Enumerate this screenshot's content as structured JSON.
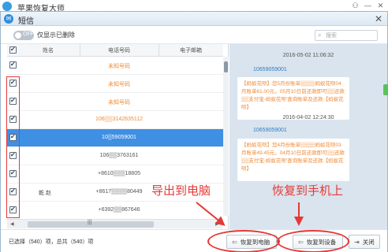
{
  "app": {
    "title": "苹果恢复大师",
    "controls": [
      "⚇",
      "—",
      "✕"
    ]
  },
  "dialog": {
    "title": "短信",
    "close": "✕"
  },
  "toolbar": {
    "toggle_text": "OFF",
    "toggle_label": "仅显示已删除",
    "search_placeholder": "搜索"
  },
  "table": {
    "columns": [
      "姓名",
      "电话号码",
      "电子邮箱"
    ],
    "rows": [
      {
        "name": "",
        "phone": "未知号码",
        "orange": true,
        "selected": false
      },
      {
        "name": "",
        "phone": "未知号码",
        "orange": true,
        "selected": false
      },
      {
        "name": "",
        "phone": "未知号码",
        "orange": true,
        "selected": false
      },
      {
        "name": "",
        "phone": "106▒▒3142635112",
        "orange": true,
        "selected": false
      },
      {
        "name": "",
        "phone": "10▒59059001",
        "orange": false,
        "selected": true
      },
      {
        "name": "",
        "phone": "106▒▒3763161",
        "orange": false,
        "selected": false
      },
      {
        "name": "",
        "phone": "+8610▒▒▒18805",
        "orange": false,
        "selected": false
      },
      {
        "name": "乾 赵",
        "phone": "+8617▒▒▒▒80449",
        "orange": false,
        "selected": false
      },
      {
        "name": "",
        "phone": "+6392▒▒867646",
        "orange": false,
        "selected": false
      }
    ]
  },
  "messages": [
    {
      "date": "2016-05-02 11:06:32",
      "sender": "10659059001",
      "text": "【蚂蚁花呗】您5月份账单▒▒▒▒蚂蚁花呗04月账单61.00元，05月10日前还款即可▒▒还款▒▒支付宝-蚂蚁花呗'查询账单及还款【蚂蚁花呗】"
    },
    {
      "date": "2016-04-02 12:24:30",
      "sender": "10659059001",
      "text": "【蚂蚁花呗】您4月份账单▒▒▒▒蚂蚁花呗03月账单49.45元，04月10日前还款即可▒▒还款▒▒支付宝-蚂蚁花呗'查询账单及还款【蚂蚁花呗】"
    }
  ],
  "status": {
    "text": "已选择（540）项，总共（540）项"
  },
  "buttons": {
    "restore_to_pc": "恢复到电脑",
    "restore_to_device": "恢复到设备",
    "close": "关闭"
  },
  "annotations": {
    "export_to_pc": "导出到电脑",
    "restore_to_phone": "恢复到手机上"
  },
  "colors": {
    "accent_blue": "#3f8fe3",
    "annotation_red": "#e53935",
    "unknown_number_orange": "#ee8a35"
  },
  "icons": [
    "app-logo-icon",
    "sms-icon",
    "search-icon",
    "restore-pc-icon",
    "restore-device-icon",
    "close-door-icon"
  ]
}
